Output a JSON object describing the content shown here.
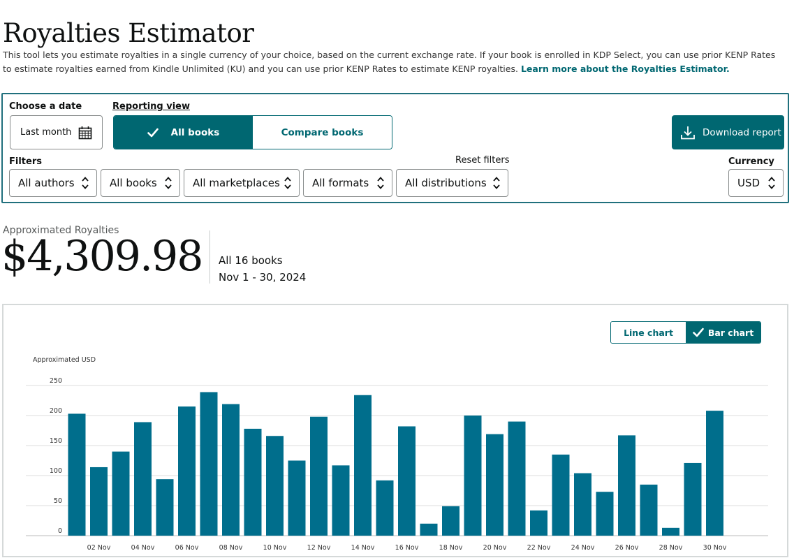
{
  "page": {
    "title": "Royalties Estimator",
    "intro": "This tool lets you estimate royalties in a single currency of your choice, based on the current exchange rate. If your book is enrolled in KDP Select, you can use prior KENP Rates to estimate royalties earned from Kindle Unlimited (KU) and you can use prior KENP Rates to estimate KENP royalties.",
    "learn_more": "Learn more about the Royalties Estimator."
  },
  "controls": {
    "date_label": "Choose a date",
    "date_value": "Last month",
    "reporting_label": "Reporting view",
    "views": [
      {
        "label": "All books",
        "active": true
      },
      {
        "label": "Compare books",
        "active": false
      }
    ],
    "download_label": "Download report",
    "filters_label": "Filters",
    "reset_label": "Reset filters",
    "currency_label": "Currency",
    "filters": [
      {
        "label": "All authors"
      },
      {
        "label": "All books"
      },
      {
        "label": "All marketplaces"
      },
      {
        "label": "All formats"
      },
      {
        "label": "All distributions"
      }
    ],
    "currency_value": "USD"
  },
  "summary": {
    "label": "Approximated Royalties",
    "value": "$4,309.98",
    "books": "All 16 books",
    "range": "Nov 1 - 30, 2024"
  },
  "chart_toggle": {
    "line_label": "Line chart",
    "bar_label": "Bar chart",
    "active": "bar"
  },
  "chart_data": {
    "type": "bar",
    "ylabel": "Approximated USD",
    "ylim": [
      0,
      250
    ],
    "yticks": [
      0,
      50,
      100,
      150,
      200,
      250
    ],
    "grid": true,
    "bar_color": "#006e8c",
    "categories": [
      "01 Nov",
      "02 Nov",
      "03 Nov",
      "04 Nov",
      "05 Nov",
      "06 Nov",
      "07 Nov",
      "08 Nov",
      "09 Nov",
      "10 Nov",
      "11 Nov",
      "12 Nov",
      "13 Nov",
      "14 Nov",
      "15 Nov",
      "16 Nov",
      "17 Nov",
      "18 Nov",
      "19 Nov",
      "20 Nov",
      "21 Nov",
      "22 Nov",
      "23 Nov",
      "24 Nov",
      "25 Nov",
      "26 Nov",
      "27 Nov",
      "28 Nov",
      "29 Nov",
      "30 Nov"
    ],
    "xtick_labels": [
      "02 Nov",
      "04 Nov",
      "06 Nov",
      "08 Nov",
      "10 Nov",
      "12 Nov",
      "14 Nov",
      "16 Nov",
      "18 Nov",
      "20 Nov",
      "22 Nov",
      "24 Nov",
      "26 Nov",
      "28 Nov",
      "30 Nov"
    ],
    "values": [
      203,
      114,
      140,
      189,
      94,
      215,
      239,
      219,
      178,
      166,
      125,
      198,
      117,
      234,
      92,
      182,
      20,
      49,
      200,
      169,
      190,
      42,
      135,
      104,
      73,
      167,
      85,
      13,
      121,
      208
    ]
  }
}
